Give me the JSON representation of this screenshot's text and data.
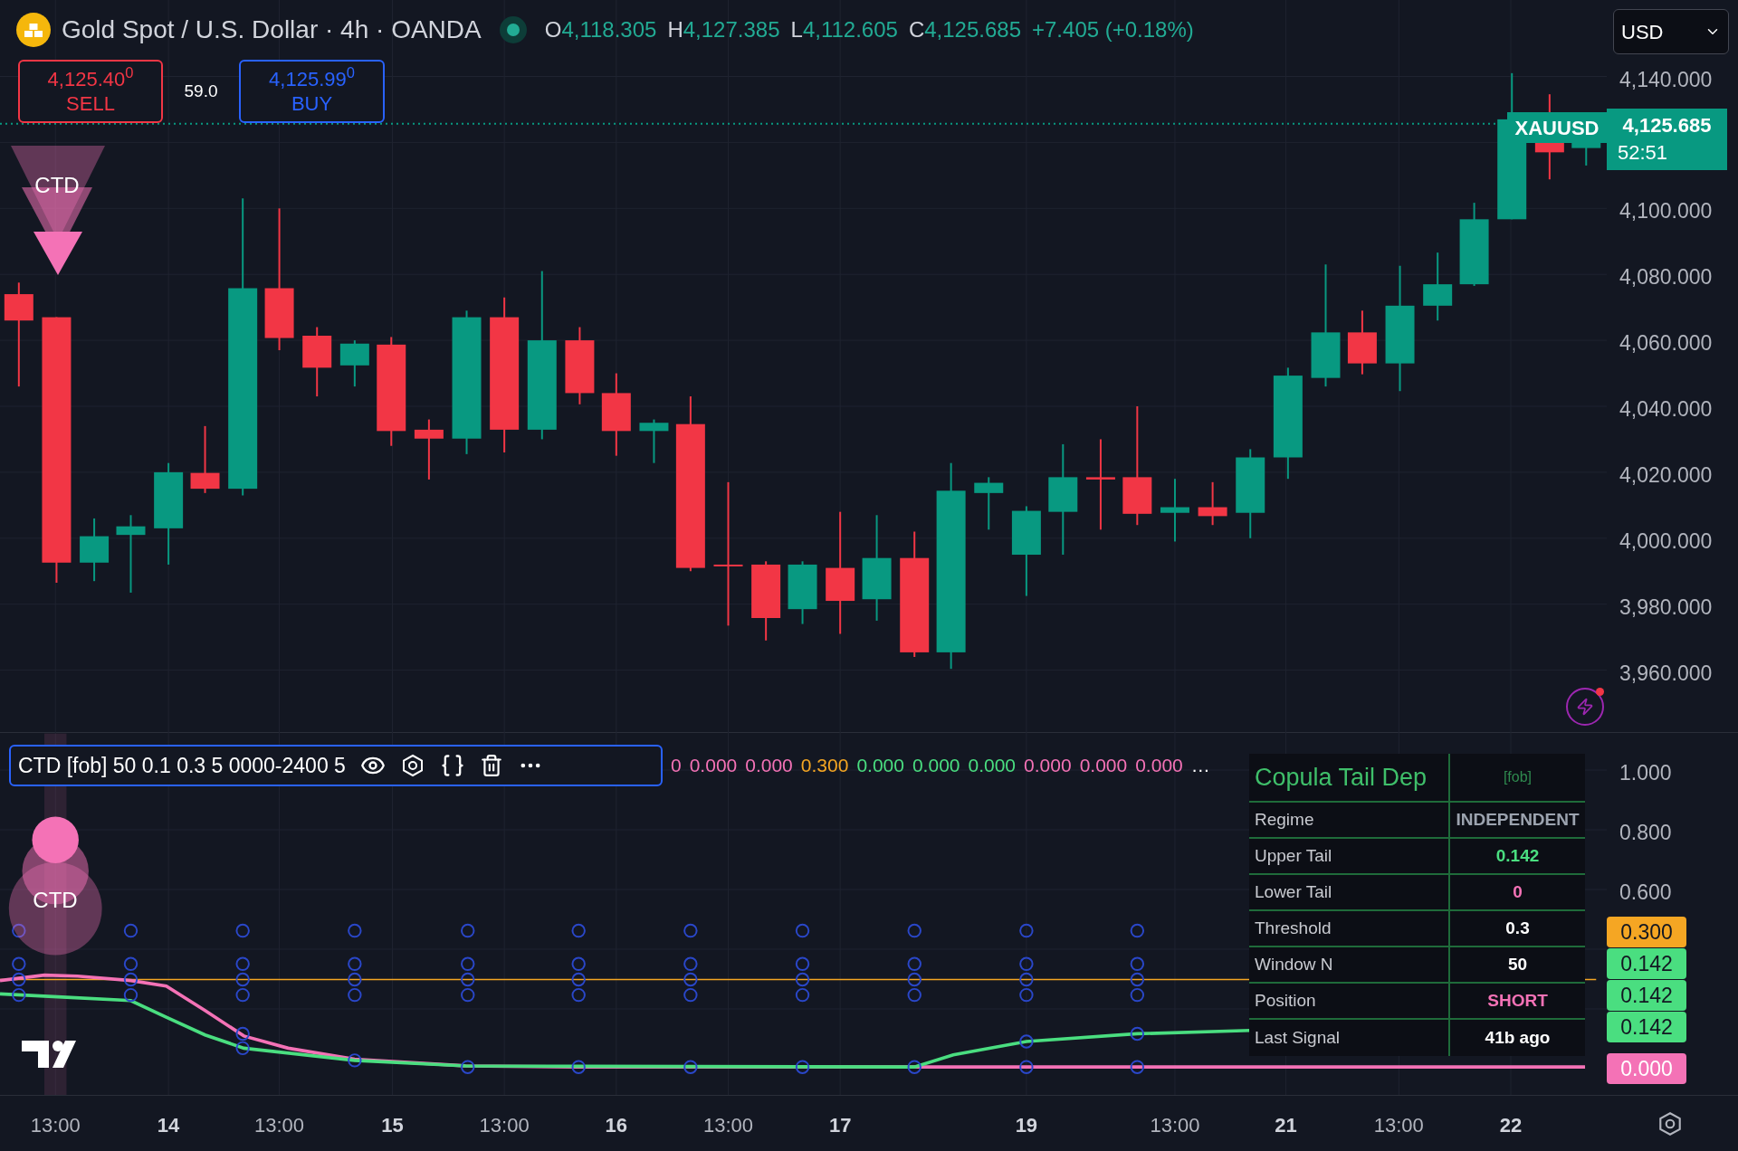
{
  "header": {
    "title": "Gold Spot / U.S. Dollar · 4h · OANDA",
    "market_open": true,
    "ohlc": [
      {
        "key": "O",
        "value": "4,118.305"
      },
      {
        "key": "H",
        "value": "4,127.385"
      },
      {
        "key": "L",
        "value": "4,112.605"
      },
      {
        "key": "C",
        "value": "4,125.685"
      }
    ],
    "change": "+7.405 (+0.18%)"
  },
  "currency_select": {
    "value": "USD"
  },
  "trade": {
    "sell": {
      "price": "4,125.40$^{0}$",
      "label": "SELL"
    },
    "spread": "59.0",
    "buy": {
      "price": "4,125.99$^{0}$",
      "label": "BUY"
    }
  },
  "main_chart": {
    "signal_label": "CTD",
    "price_axis": [
      "4,140.000",
      "4,100.000",
      "4,080.000",
      "4,060.000",
      "4,040.000",
      "4,020.000",
      "4,000.000",
      "3,980.000",
      "3,960.000"
    ],
    "symbol_tag": "XAUUSD",
    "last_price": "4,125.685",
    "countdown": "52:51"
  },
  "indicator": {
    "legend": "CTD [fob] 50 0.1 0.3 5 0000-2400 5",
    "values": [
      {
        "text": "0",
        "color": "#f472b6"
      },
      {
        "text": "0.000",
        "color": "#f472b6"
      },
      {
        "text": "0.000",
        "color": "#f472b6"
      },
      {
        "text": "0.300",
        "color": "#f5a623"
      },
      {
        "text": "0.000",
        "color": "#4ade80"
      },
      {
        "text": "0.000",
        "color": "#4ade80"
      },
      {
        "text": "0.000",
        "color": "#4ade80"
      },
      {
        "text": "0.000",
        "color": "#f472b6"
      },
      {
        "text": "0.000",
        "color": "#f472b6"
      },
      {
        "text": "0.000",
        "color": "#f472b6"
      }
    ],
    "more": "…",
    "signal_label": "CTD",
    "axis": [
      "1.000",
      "0.800",
      "0.600"
    ],
    "value_tags": [
      {
        "text": "0.300",
        "color": "#f5a623"
      },
      {
        "text": "0.142",
        "color": "#4ade80"
      },
      {
        "text": "0.142",
        "color": "#4ade80"
      },
      {
        "text": "0.142",
        "color": "#4ade80"
      },
      {
        "text": "0.000",
        "color": "#f472b6"
      }
    ],
    "table": {
      "title": "Copula Tail Dep",
      "tag": "[fob]",
      "rows": [
        {
          "label": "Regime",
          "value": "INDEPENDENT",
          "color": "#9ca3af"
        },
        {
          "label": "Upper Tail",
          "value": "0.142",
          "color": "#4ade80"
        },
        {
          "label": "Lower Tail",
          "value": "0",
          "color": "#f472b6"
        },
        {
          "label": "Threshold",
          "value": "0.3",
          "color": "#ffffff"
        },
        {
          "label": "Window N",
          "value": "50",
          "color": "#ffffff"
        },
        {
          "label": "Position",
          "value": "SHORT",
          "color": "#f472b6"
        },
        {
          "label": "Last Signal",
          "value": "41b ago",
          "color": "#ffffff"
        }
      ]
    }
  },
  "time_axis": [
    {
      "label": "13:00",
      "kind": "time"
    },
    {
      "label": "14",
      "kind": "day"
    },
    {
      "label": "13:00",
      "kind": "time"
    },
    {
      "label": "15",
      "kind": "day"
    },
    {
      "label": "13:00",
      "kind": "time"
    },
    {
      "label": "16",
      "kind": "day"
    },
    {
      "label": "13:00",
      "kind": "time"
    },
    {
      "label": "17",
      "kind": "day"
    },
    {
      "label": "19",
      "kind": "day"
    },
    {
      "label": "13:00",
      "kind": "time"
    },
    {
      "label": "21",
      "kind": "day"
    },
    {
      "label": "13:00",
      "kind": "time"
    },
    {
      "label": "22",
      "kind": "day"
    }
  ]
}
